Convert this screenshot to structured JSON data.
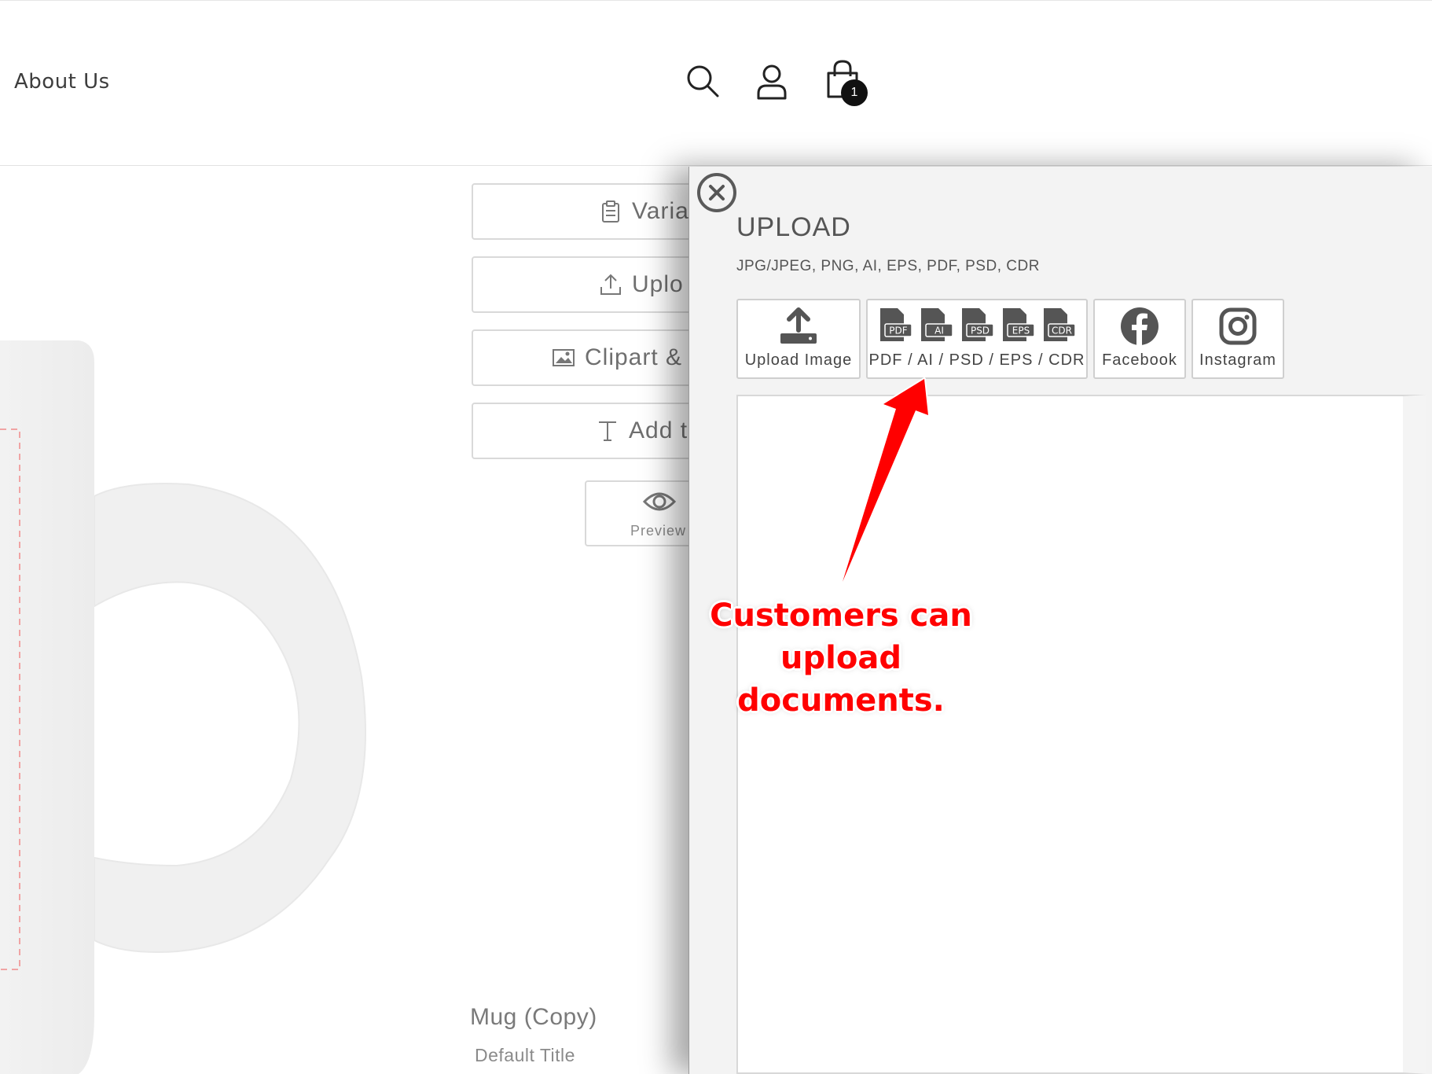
{
  "header": {
    "nav_about": "About Us",
    "cart_count": "1",
    "icons": [
      "search-icon",
      "user-icon",
      "cart-icon"
    ]
  },
  "product": {
    "side_buttons": [
      {
        "label": "Variar",
        "icon": "clipboard-icon"
      },
      {
        "label": "Uplo",
        "icon": "upload-icon"
      },
      {
        "label": "Clipart &",
        "icon": "image-icon"
      },
      {
        "label": "Add t",
        "icon": "text-icon"
      }
    ],
    "preview_label": "Preview",
    "title": "Mug (Copy)",
    "variant": "Default Title"
  },
  "upload_panel": {
    "title": "UPLOAD",
    "formats": "JPG/JPEG, PNG, AI, EPS, PDF, PSD, CDR",
    "buttons": [
      {
        "label": "Upload Image",
        "icon": "upload-tray-icon"
      },
      {
        "label": "PDF / AI / PSD / EPS / CDR",
        "icon": "document-types-icon",
        "types": [
          "PDF",
          "AI",
          "PSD",
          "EPS",
          "CDR"
        ]
      },
      {
        "label": "Facebook",
        "icon": "facebook-icon"
      },
      {
        "label": "Instagram",
        "icon": "instagram-icon"
      }
    ]
  },
  "annotation": {
    "line1": "Customers can upload",
    "line2": "documents.",
    "color": "#ff0000"
  }
}
